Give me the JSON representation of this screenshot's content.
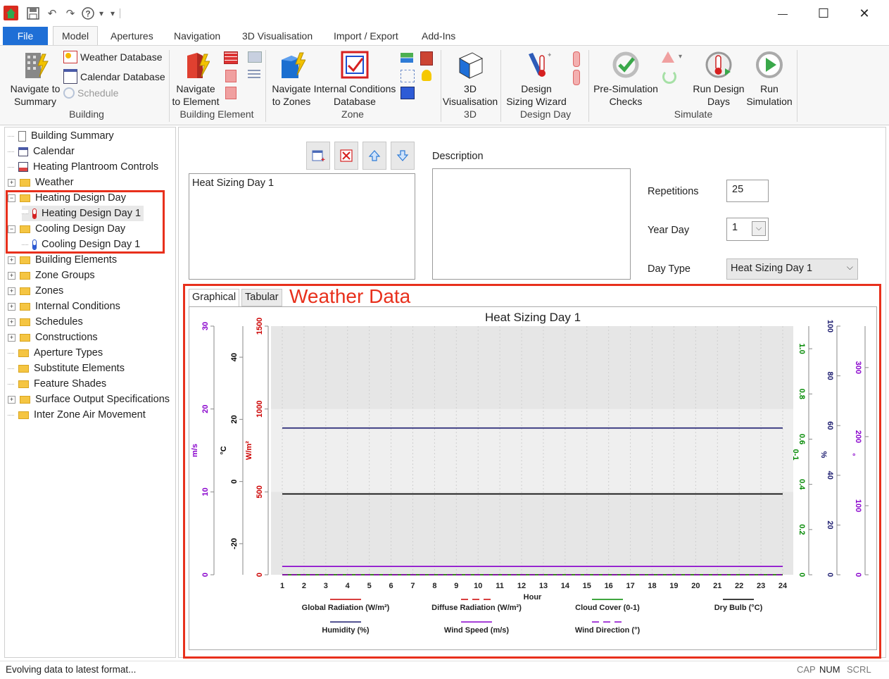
{
  "quick_access": {
    "dropdown_glyph": "▾",
    "more_glyph": "▾"
  },
  "window_controls": {
    "minimize": "—",
    "maximize": "☐",
    "close": "✕"
  },
  "menu_tabs": [
    "File",
    "Model",
    "Apertures",
    "Navigation",
    "3D Visualisation",
    "Import / Export",
    "Add-Ins"
  ],
  "ribbon": {
    "building": {
      "navigate_summary": [
        "Navigate to",
        "Summary"
      ],
      "weather_db": "Weather Database",
      "calendar_db": "Calendar Database",
      "schedule": "Schedule",
      "group": "Building"
    },
    "building_element": {
      "navigate_element": [
        "Navigate",
        "to Element"
      ],
      "group": "Building Element"
    },
    "zone": {
      "navigate_zones": [
        "Navigate",
        "to Zones"
      ],
      "internal_conditions": [
        "Internal Conditions",
        "Database"
      ],
      "group": "Zone"
    },
    "threed": {
      "vis": [
        "3D",
        "Visualisation"
      ],
      "group": "3D"
    },
    "design_day": {
      "wizard": [
        "Design",
        "Sizing Wizard"
      ],
      "group": "Design Day"
    },
    "simulate": {
      "pre_sim": [
        "Pre-Simulation",
        "Checks"
      ],
      "run_design": [
        "Run Design",
        "Days"
      ],
      "run_sim": [
        "Run",
        "Simulation"
      ],
      "group": "Simulate"
    }
  },
  "tree": [
    {
      "label": "Building Summary",
      "level": 0,
      "expander": "",
      "icon": "building-icon"
    },
    {
      "label": "Calendar",
      "level": 0,
      "expander": "",
      "icon": "calendar-icon"
    },
    {
      "label": "Heating Plantroom Controls",
      "level": 0,
      "expander": "",
      "icon": "controls-icon"
    },
    {
      "label": "Weather",
      "level": 0,
      "expander": "+",
      "icon": "folder-icon"
    },
    {
      "label": "Heating Design Day",
      "level": 0,
      "expander": "−",
      "icon": "folder-icon"
    },
    {
      "label": "Heating Design Day 1",
      "level": 1,
      "expander": "",
      "icon": "thermometer-hot-icon",
      "selected": true
    },
    {
      "label": "Cooling Design Day",
      "level": 0,
      "expander": "−",
      "icon": "folder-icon"
    },
    {
      "label": "Cooling Design Day 1",
      "level": 1,
      "expander": "",
      "icon": "thermometer-cold-icon"
    },
    {
      "label": "Building Elements",
      "level": 0,
      "expander": "+",
      "icon": "folder-icon"
    },
    {
      "label": "Zone Groups",
      "level": 0,
      "expander": "+",
      "icon": "folder-icon"
    },
    {
      "label": "Zones",
      "level": 0,
      "expander": "+",
      "icon": "folder-icon"
    },
    {
      "label": "Internal Conditions",
      "level": 0,
      "expander": "+",
      "icon": "folder-icon"
    },
    {
      "label": "Schedules",
      "level": 0,
      "expander": "+",
      "icon": "folder-icon"
    },
    {
      "label": "Constructions",
      "level": 0,
      "expander": "+",
      "icon": "folder-icon"
    },
    {
      "label": "Aperture Types",
      "level": 0,
      "expander": "",
      "icon": "folder-icon"
    },
    {
      "label": "Substitute Elements",
      "level": 0,
      "expander": "",
      "icon": "folder-icon"
    },
    {
      "label": "Feature Shades",
      "level": 0,
      "expander": "",
      "icon": "folder-icon"
    },
    {
      "label": "Surface Output Specifications",
      "level": 0,
      "expander": "+",
      "icon": "folder-icon"
    },
    {
      "label": "Inter Zone Air Movement",
      "level": 0,
      "expander": "",
      "icon": "folder-icon"
    }
  ],
  "form": {
    "name_value": "Heat Sizing Day 1",
    "description_label": "Description",
    "description_value": "",
    "repetitions_label": "Repetitions",
    "repetitions_value": "25",
    "year_day_label": "Year Day",
    "year_day_value": "1",
    "day_type_label": "Day Type",
    "day_type_value": "Heat Sizing Day 1"
  },
  "data_tabs": [
    "Graphical",
    "Tabular"
  ],
  "annotation": "Weather Data",
  "status": {
    "message": "Evolving data to latest format...",
    "indicators": [
      "CAP",
      "NUM",
      "SCRL"
    ]
  },
  "colors": {
    "file_tab": "#1f6fd6",
    "highlight": "#e8301c",
    "radiation": "#cc0000",
    "cloud": "#008800",
    "drybulb": "#000000",
    "humidity": "#1a1a6e",
    "wind": "#8800cc"
  },
  "chart_data": {
    "type": "line",
    "title": "Heat Sizing Day 1",
    "xlabel": "Hour",
    "x": [
      1,
      2,
      3,
      4,
      5,
      6,
      7,
      8,
      9,
      10,
      11,
      12,
      13,
      14,
      15,
      16,
      17,
      18,
      19,
      20,
      21,
      22,
      23,
      24
    ],
    "xlim": [
      1,
      24
    ],
    "axes": {
      "wind_speed": {
        "unit": "m/s",
        "ticks": [
          "0",
          "10",
          "20",
          "30"
        ],
        "range": [
          0,
          30
        ]
      },
      "dry_bulb": {
        "unit": "°C",
        "ticks": [
          "-20",
          "0",
          "20",
          "40"
        ],
        "range": [
          -30,
          50
        ]
      },
      "radiation": {
        "unit": "W/m²",
        "ticks": [
          "0",
          "500",
          "1000",
          "1500"
        ],
        "range": [
          0,
          1500
        ]
      },
      "cloud_cover": {
        "unit": "0-1",
        "ticks": [
          "0",
          "0.2",
          "0.4",
          "0.6",
          "0.8",
          "1.0"
        ],
        "range": [
          0,
          1.1
        ]
      },
      "humidity": {
        "unit": "%",
        "ticks": [
          "0",
          "20",
          "40",
          "60",
          "80",
          "100"
        ],
        "range": [
          0,
          100
        ]
      },
      "wind_direction": {
        "unit": "°",
        "ticks": [
          "0",
          "100",
          "200",
          "300"
        ],
        "range": [
          0,
          360
        ]
      }
    },
    "series": [
      {
        "name": "Global Radiation (W/m²)",
        "axis": "radiation",
        "color": "#cc0000",
        "dash": "solid",
        "values": [
          0,
          0,
          0,
          0,
          0,
          0,
          0,
          0,
          0,
          0,
          0,
          0,
          0,
          0,
          0,
          0,
          0,
          0,
          0,
          0,
          0,
          0,
          0,
          0
        ]
      },
      {
        "name": "Diffuse Radiation (W/m²)",
        "axis": "radiation",
        "color": "#cc0000",
        "dash": "dashed",
        "values": [
          0,
          0,
          0,
          0,
          0,
          0,
          0,
          0,
          0,
          0,
          0,
          0,
          0,
          0,
          0,
          0,
          0,
          0,
          0,
          0,
          0,
          0,
          0,
          0
        ]
      },
      {
        "name": "Cloud Cover (0-1)",
        "axis": "cloud_cover",
        "color": "#008800",
        "dash": "solid",
        "values": [
          0,
          0,
          0,
          0,
          0,
          0,
          0,
          0,
          0,
          0,
          0,
          0,
          0,
          0,
          0,
          0,
          0,
          0,
          0,
          0,
          0,
          0,
          0,
          0
        ]
      },
      {
        "name": "Dry Bulb (°C)",
        "axis": "dry_bulb",
        "color": "#000000",
        "dash": "solid",
        "values": [
          -4,
          -4,
          -4,
          -4,
          -4,
          -4,
          -4,
          -4,
          -4,
          -4,
          -4,
          -4,
          -4,
          -4,
          -4,
          -4,
          -4,
          -4,
          -4,
          -4,
          -4,
          -4,
          -4,
          -4
        ]
      },
      {
        "name": "Humidity (%)",
        "axis": "humidity",
        "color": "#1a1a6e",
        "dash": "solid",
        "values": [
          59,
          59,
          59,
          59,
          59,
          59,
          59,
          59,
          59,
          59,
          59,
          59,
          59,
          59,
          59,
          59,
          59,
          59,
          59,
          59,
          59,
          59,
          59,
          59
        ]
      },
      {
        "name": "Wind Speed (m/s)",
        "axis": "wind_speed",
        "color": "#8800cc",
        "dash": "solid",
        "values": [
          1,
          1,
          1,
          1,
          1,
          1,
          1,
          1,
          1,
          1,
          1,
          1,
          1,
          1,
          1,
          1,
          1,
          1,
          1,
          1,
          1,
          1,
          1,
          1
        ]
      },
      {
        "name": "Wind Direction (°)",
        "axis": "wind_direction",
        "color": "#8800cc",
        "dash": "dashed",
        "values": [
          0,
          0,
          0,
          0,
          0,
          0,
          0,
          0,
          0,
          0,
          0,
          0,
          0,
          0,
          0,
          0,
          0,
          0,
          0,
          0,
          0,
          0,
          0,
          0
        ]
      }
    ],
    "grid": true,
    "legend": "bottom"
  }
}
